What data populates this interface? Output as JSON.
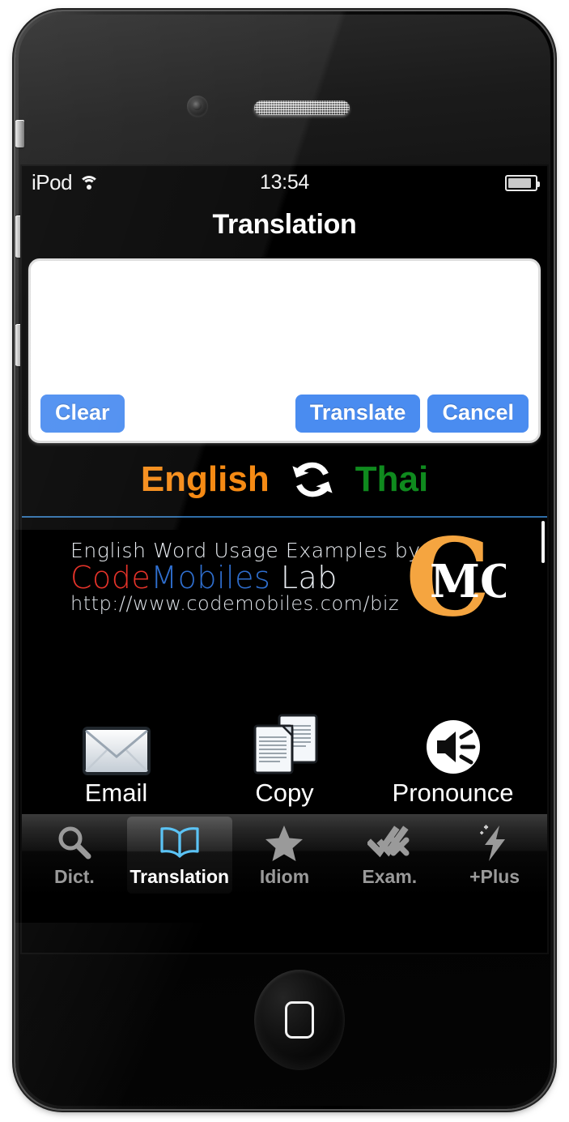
{
  "device": {
    "name": "iPod touch",
    "home_button": "home-button"
  },
  "status_bar": {
    "carrier": "iPod",
    "wifi_icon": "wifi-icon",
    "time": "13:54",
    "battery_icon": "battery-icon"
  },
  "nav_bar": {
    "title": "Translation"
  },
  "input_panel": {
    "text_value": "",
    "placeholder": "",
    "buttons": {
      "clear": "Clear",
      "translate": "Translate",
      "cancel": "Cancel"
    }
  },
  "language_bar": {
    "source": "English",
    "target": "Thai",
    "swap_icon": "swap-arrows-icon",
    "source_color": "#f58a14",
    "target_color": "#0f8a1e"
  },
  "banner": {
    "line1": "English Word Usage Examples by",
    "brand_code": "Code",
    "brand_mobiles": "Mobiles",
    "brand_lab": " Lab",
    "url": "http://www.codemobiles.com/biz",
    "logo_text_c": "C",
    "logo_text_mo": "MO",
    "logo_color": "#f5a540"
  },
  "actions": [
    {
      "label": "Email",
      "icon": "envelope-icon"
    },
    {
      "label": "Copy",
      "icon": "documents-icon"
    },
    {
      "label": "Pronounce",
      "icon": "speaker-icon"
    }
  ],
  "tabs": [
    {
      "label": "Dict.",
      "icon": "magnifier-icon",
      "active": false
    },
    {
      "label": "Translation",
      "icon": "open-book-icon",
      "active": true
    },
    {
      "label": "Idiom",
      "icon": "star-icon",
      "active": false
    },
    {
      "label": "Exam.",
      "icon": "check-x-icon",
      "active": false
    },
    {
      "label": "+Plus",
      "icon": "lightning-bolt-icon",
      "active": false
    }
  ]
}
